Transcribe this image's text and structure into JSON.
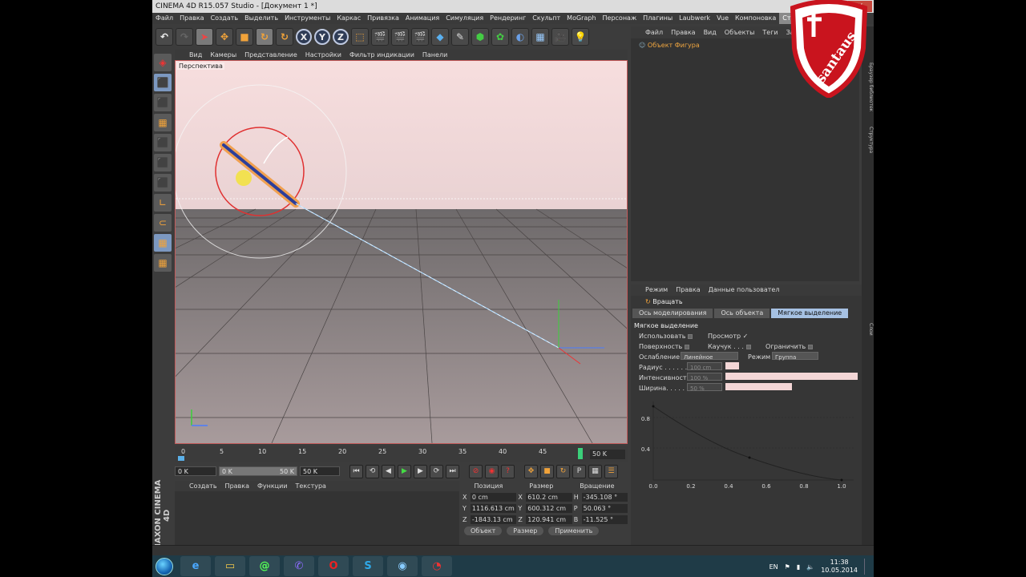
{
  "window": {
    "title": "CINEMA 4D R15.057 Studio - [Документ 1 *]"
  },
  "menu": [
    "Файл",
    "Правка",
    "Создать",
    "Выделить",
    "Инструменты",
    "Каркас",
    "Привязка",
    "Анимация",
    "Симуляция",
    "Рендеринг",
    "Скульпт",
    "MoGraph",
    "Персонаж",
    "Плагины",
    "Laubwerk",
    "Vue",
    "Компоновка",
    "Стартовая"
  ],
  "toolbar": {
    "x": "X",
    "y": "Y",
    "z": "Z"
  },
  "viewport": {
    "menu": [
      "Вид",
      "Камеры",
      "Представление",
      "Настройки",
      "Фильтр индикации",
      "Панели"
    ],
    "label": "Перспектива"
  },
  "timeline": {
    "ticks": [
      "0",
      "5",
      "10",
      "15",
      "20",
      "25",
      "30",
      "35",
      "40",
      "45"
    ],
    "end": "50 K"
  },
  "transport": {
    "start": "0 K",
    "range_start": "0 K",
    "range_end": "50 K",
    "end": "50 K"
  },
  "material": {
    "menu": [
      "Создать",
      "Правка",
      "Функции",
      "Текстура"
    ]
  },
  "coords": {
    "headers": [
      "Позиция",
      "Размер",
      "Вращение"
    ],
    "rows": [
      {
        "axis": "X",
        "pos": "0 cm",
        "size_axis": "X",
        "size": "610.2 cm",
        "rot_axis": "H",
        "rot": "-345.108 °"
      },
      {
        "axis": "Y",
        "pos": "1116.613 cm",
        "size_axis": "Y",
        "size": "600.312 cm",
        "rot_axis": "P",
        "rot": "50.063 °"
      },
      {
        "axis": "Z",
        "pos": "-1843.13 cm",
        "size_axis": "Z",
        "size": "120.941 cm",
        "rot_axis": "B",
        "rot": "-11.525 °"
      }
    ],
    "buttons": {
      "object": "Объект",
      "size": "Размер",
      "apply": "Применить"
    }
  },
  "objmgr": {
    "menu": [
      "Файл",
      "Правка",
      "Вид",
      "Объекты",
      "Теги",
      "Заклад"
    ],
    "object": "Объект Фигура"
  },
  "attr": {
    "menu": [
      "Режим",
      "Правка",
      "Данные пользовател"
    ],
    "title": "Вращать",
    "tabs": [
      "Ось моделирования",
      "Ось объекта",
      "Мягкое выделение"
    ],
    "section": "Мягкое выделение",
    "use": "Использовать",
    "preview": "Просмотр",
    "surface": "Поверхность",
    "rubber": "Каучук . . .",
    "limit": "Ограничить",
    "falloff": "Ослабление",
    "falloff_val": "Линейное",
    "mode": "Режим",
    "mode_val": "Группа",
    "radius": "Радиус . . . . . .",
    "radius_val": "100 cm",
    "intensity": "Интенсивность",
    "intensity_val": "100 %",
    "width": "Ширина. . . . .",
    "width_val": "50 %",
    "curve_y": [
      "0.8",
      "0.4"
    ],
    "curve_x": [
      "0.0",
      "0.2",
      "0.4",
      "0.6",
      "0.8",
      "1.0"
    ]
  },
  "sidetabs": [
    "Браузер библиотек",
    "Структура",
    "Слои"
  ],
  "logo": "santaus",
  "maxon": "MAXON CINEMA 4D",
  "tray": {
    "lang": "EN",
    "time": "11:38",
    "date": "10.05.2014"
  }
}
